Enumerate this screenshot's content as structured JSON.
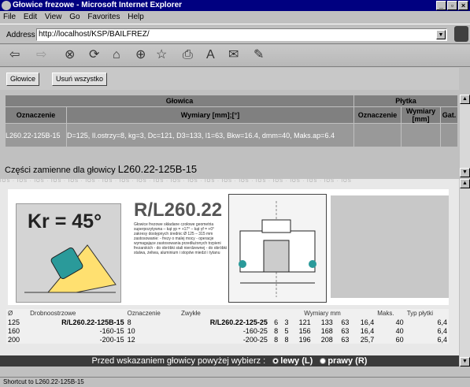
{
  "window": {
    "title": "Głowice frezowe - Microsoft Internet Explorer"
  },
  "menu": [
    "File",
    "Edit",
    "View",
    "Go",
    "Favorites",
    "Help"
  ],
  "address": {
    "label": "Address",
    "url": "http://localhost/KSP/BAILFREZ/"
  },
  "frame_buttons": {
    "glowice": "Głowice",
    "usun": "Usuń wszystko"
  },
  "table": {
    "head_glowica": "Głowica",
    "head_plytka": "Płytka",
    "col_oznaczenie": "Oznaczenie",
    "col_wymiary": "Wymiary [mm];[°]",
    "col_p_oznaczenie": "Oznaczenie",
    "col_p_wymiary": "Wymiary [mm]",
    "col_p_gat": "Gat.",
    "row_oznaczenie": "L260.22-125B-15",
    "row_wymiary": "D=125, Il.ostrzy=8, kg=3, Dc=121, D3=133, l1=63, Bkw=16.4, dmm=40, Maks.ap=6.4"
  },
  "spare_parts": {
    "label": "Części zamienne dla głowicy",
    "code": "L260.22-125B-15"
  },
  "catalog": {
    "kr_label": "Kr = 45°",
    "rl_title": "R/L260.22",
    "rl_desc": "Głowice frezowe składane czołowe geometria superpozytywna – kąt γp = +17° – kąt γf = +0° zakresy dostępnych średnic Ø 125 – 315 mm zastosowanie: - frezy o malej mocy - operacje wymagające zastosowania przedłużonych trzpieni frezarskich - do obróbki stali nierdzewnej - do obróbki stalwa, żeliwa, aluminium i stopów miedzi i tytanu",
    "hdr_oznaczenie": "Oznaczenie",
    "hdr_wymiary": "Wymiary mm",
    "hdr_typ": "Typ płytki",
    "hdr_drobno": "Drobnoostrzowe",
    "hdr_zwykle": "Zwykłe",
    "hdr_maks": "Maks.",
    "rows": [
      [
        "125",
        "R/L260.22-125B-15",
        "8",
        "R/L260.22-125-25",
        "6",
        "3",
        "121",
        "133",
        "63",
        "16,4",
        "40",
        "6,4"
      ],
      [
        "160",
        "-160-15",
        "10",
        "-160-25",
        "8",
        "5",
        "156",
        "168",
        "63",
        "16,4",
        "40",
        "6,4"
      ],
      [
        "200",
        "-200-15",
        "12",
        "-200-25",
        "8",
        "8",
        "196",
        "208",
        "63",
        "25,7",
        "60",
        "6,4"
      ]
    ]
  },
  "choose": {
    "text": "Przed wskazaniem głowicy powyżej wybierz :",
    "lewy": "lewy (L)",
    "prawy": "prawy (R)"
  },
  "status": {
    "text": "Shortcut to L260.22-125B-15"
  }
}
